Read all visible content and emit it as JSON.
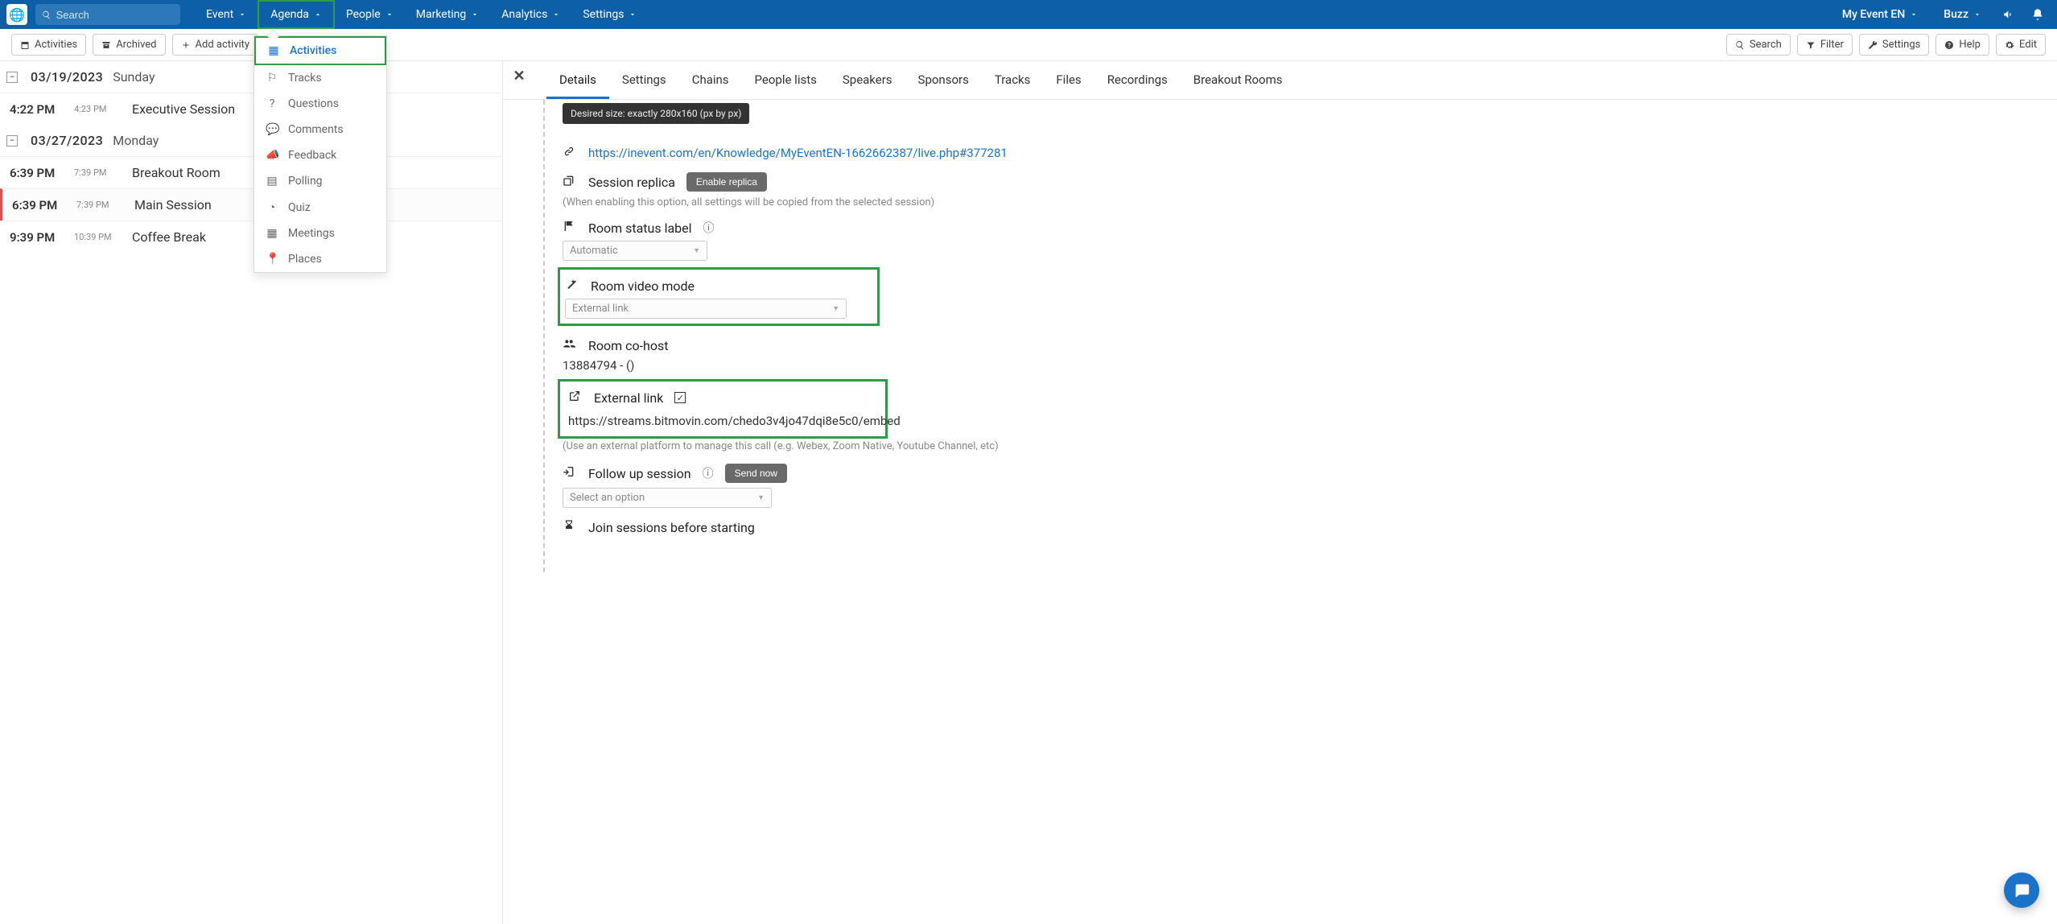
{
  "top": {
    "search_placeholder": "Search",
    "nav": [
      "Event",
      "Agenda",
      "People",
      "Marketing",
      "Analytics",
      "Settings"
    ],
    "active_nav_idx": 1,
    "event_name": "My Event EN",
    "user": "Buzz"
  },
  "toolbar": {
    "activities": "Activities",
    "archived": "Archived",
    "add_activity": "Add activity",
    "search": "Search",
    "filter": "Filter",
    "settings": "Settings",
    "help": "Help",
    "edit": "Edit"
  },
  "dropdown": {
    "items": [
      "Activities",
      "Tracks",
      "Questions",
      "Comments",
      "Feedback",
      "Polling",
      "Quiz",
      "Meetings",
      "Places"
    ],
    "selected_idx": 0
  },
  "dates": [
    {
      "date": "03/19/2023",
      "day": "Sunday",
      "rows": [
        {
          "start": "4:22 PM",
          "end": "4:23 PM",
          "name": "Executive Session",
          "selected": false
        }
      ]
    },
    {
      "date": "03/27/2023",
      "day": "Monday",
      "rows": [
        {
          "start": "6:39 PM",
          "end": "7:39 PM",
          "name": "Breakout Room",
          "selected": false
        },
        {
          "start": "6:39 PM",
          "end": "7:39 PM",
          "name": "Main Session",
          "selected": true
        },
        {
          "start": "9:39 PM",
          "end": "10:39 PM",
          "name": "Coffee Break",
          "selected": false
        }
      ]
    }
  ],
  "tabs": [
    "Details",
    "Settings",
    "Chains",
    "People lists",
    "Speakers",
    "Sponsors",
    "Tracks",
    "Files",
    "Recordings",
    "Breakout Rooms"
  ],
  "active_tab_idx": 0,
  "detail": {
    "size_hint": "Desired size: exactly 280x160 (px by px)",
    "live_url": "https://inevent.com/en/Knowledge/MyEventEN-1662662387/live.php#377281",
    "replica_label": "Session replica",
    "replica_btn": "Enable replica",
    "replica_help": "(When enabling this option, all settings will be copied from the selected session)",
    "status_label": "Room status label",
    "status_value": "Automatic",
    "video_mode_label": "Room video mode",
    "video_mode_value": "External link",
    "cohost_label": "Room co-host",
    "cohost_value": "13884794 - ()",
    "ext_link_label": "External link",
    "ext_link_value": "https://streams.bitmovin.com/chedo3v4jo47dqi8e5c0/embed",
    "ext_link_help": "(Use an external platform to manage this call (e.g. Webex, Zoom Native, Youtube Channel, etc)",
    "followup_label": "Follow up session",
    "followup_btn": "Send now",
    "followup_value": "Select an option",
    "join_before_label": "Join sessions before starting"
  }
}
